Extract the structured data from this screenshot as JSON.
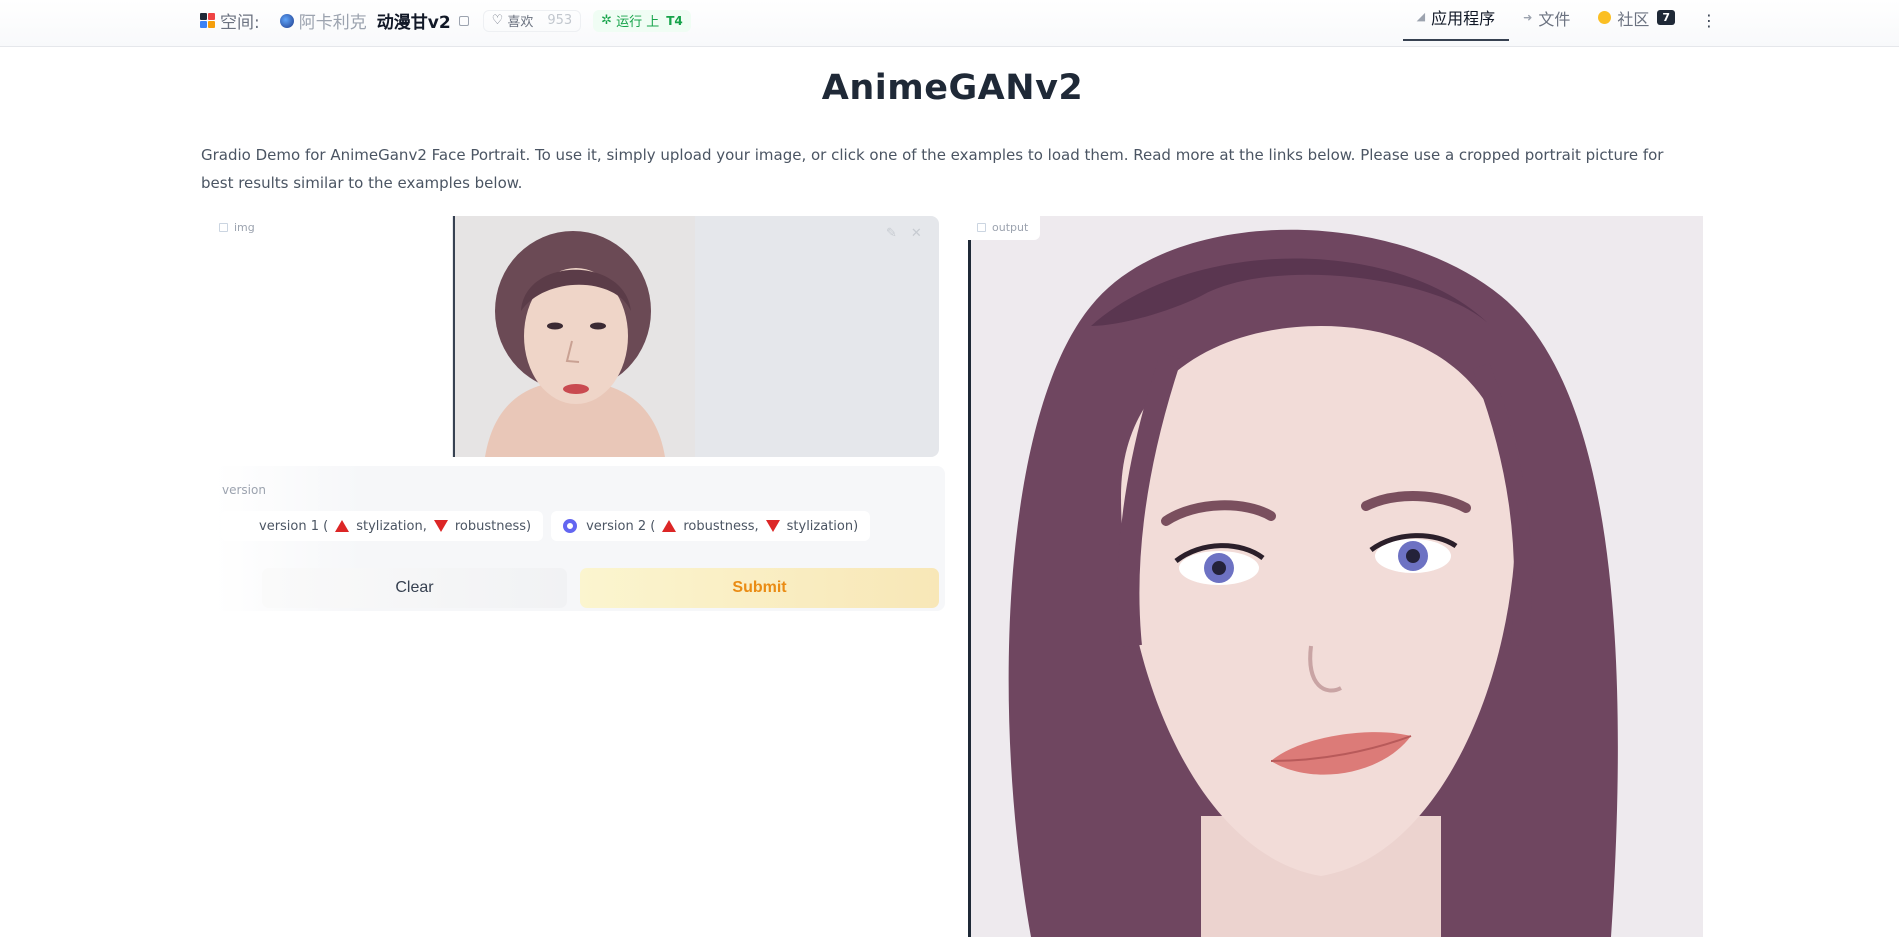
{
  "header": {
    "spaces_label": "空间:",
    "owner": "阿卡利克",
    "repo_name": "动漫甘v2",
    "like_label": "喜欢",
    "like_count": "953",
    "status_label": "运行 上",
    "hardware": "T4",
    "tabs": [
      {
        "label": "应用程序",
        "icon": "app-icon",
        "active": true
      },
      {
        "label": "文件",
        "icon": "files-icon",
        "active": false
      },
      {
        "label": "社区",
        "icon": "community-icon",
        "active": false,
        "count": "7"
      }
    ]
  },
  "main": {
    "title": "AnimeGANv2",
    "description": "Gradio Demo for AnimeGanv2 Face Portrait. To use it, simply upload your image, or click one of the examples to load them. Read more at the links below. Please use a cropped portrait picture for best results similar to the examples below."
  },
  "input": {
    "label": "img",
    "icon": "image-icon"
  },
  "version": {
    "label": "version",
    "options": [
      {
        "text_a": "version 1 (",
        "word1": "stylization,",
        "word2": "robustness)",
        "selected": false
      },
      {
        "text_a": "version 2 (",
        "word1": "robustness,",
        "word2": "stylization)",
        "selected": true
      }
    ]
  },
  "buttons": {
    "clear": "Clear",
    "submit": "Submit"
  },
  "output": {
    "label": "output",
    "icon": "image-icon"
  },
  "colors": {
    "accent_radio": "#6366f1",
    "submit_text": "#ea8c14",
    "running": "#16a34a",
    "triangle": "#dc2626"
  }
}
